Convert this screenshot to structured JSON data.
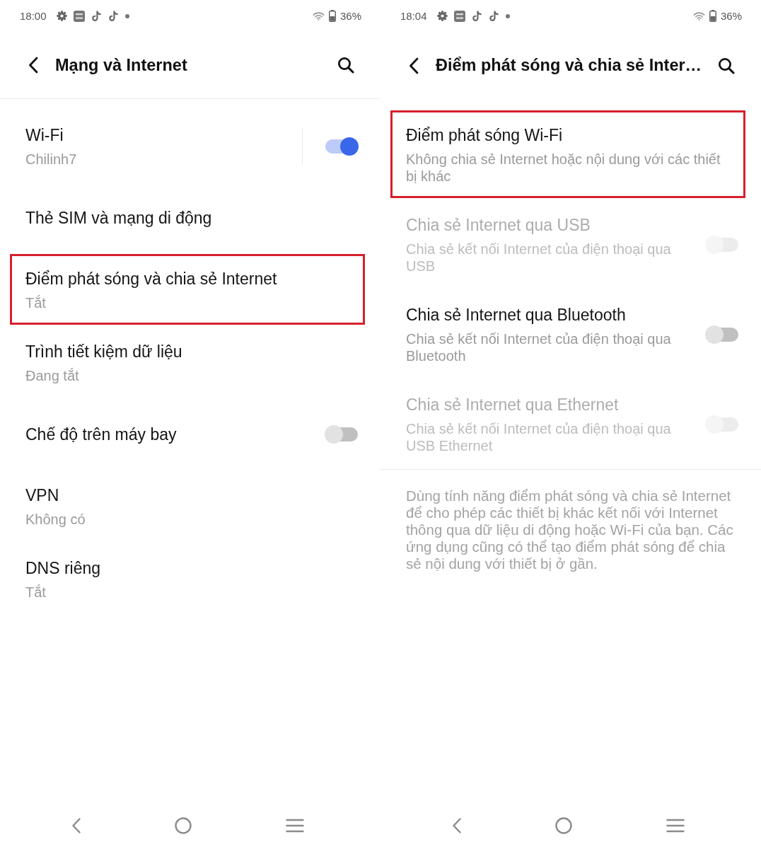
{
  "screens": [
    {
      "status_bar": {
        "time": "18:00",
        "battery": "36%"
      },
      "header": {
        "title": "Mạng và Internet",
        "divider": true
      },
      "items": [
        {
          "kind": "split-switch",
          "title": "Wi-Fi",
          "summary": "Chilinh7",
          "on": true,
          "disabled": false,
          "highlighted": false
        },
        {
          "kind": "link",
          "title": "Thẻ SIM và mạng di động",
          "disabled": false,
          "highlighted": false
        },
        {
          "kind": "link",
          "title": "Điểm phát sóng và chia sẻ Internet",
          "summary": "Tắt",
          "disabled": false,
          "highlighted": true
        },
        {
          "kind": "link",
          "title": "Trình tiết kiệm dữ liệu",
          "summary": "Đang tắt",
          "disabled": false,
          "highlighted": false
        },
        {
          "kind": "switch",
          "title": "Chế độ trên máy bay",
          "on": false,
          "disabled": false,
          "highlighted": false
        },
        {
          "kind": "link",
          "title": "VPN",
          "summary": "Không có",
          "disabled": false,
          "highlighted": false
        },
        {
          "kind": "link",
          "title": "DNS riêng",
          "summary": "Tắt",
          "disabled": false,
          "highlighted": false
        }
      ]
    },
    {
      "status_bar": {
        "time": "18:04",
        "battery": "36%"
      },
      "header": {
        "title": "Điểm phát sóng và chia sẻ Inter…",
        "divider": false
      },
      "items": [
        {
          "kind": "link",
          "title": "Điểm phát sóng Wi-Fi",
          "summary": "Không chia sẻ Internet hoặc nội dung với các thiết bị khác",
          "disabled": false,
          "highlighted": true
        },
        {
          "kind": "switch",
          "title": "Chia sẻ Internet qua USB",
          "summary": "Chia sẻ kết nối Internet của điện thoại qua USB",
          "on": false,
          "disabled": true,
          "highlighted": false
        },
        {
          "kind": "switch",
          "title": "Chia sẻ Internet qua Bluetooth",
          "summary": "Chia sẻ kết nối Internet của điện thoại qua Bluetooth",
          "on": false,
          "disabled": false,
          "highlighted": false
        },
        {
          "kind": "switch",
          "title": "Chia sẻ Internet qua Ethernet",
          "summary": "Chia sẻ kết nối Internet của điện thoại qua USB Ethernet",
          "on": false,
          "disabled": true,
          "highlighted": false
        }
      ],
      "footer_note": "Dùng tính năng điểm phát sóng và chia sẻ Internet để cho phép các thiết bị khác kết nối với Internet thông qua dữ liệu di động hoặc Wi-Fi của bạn. Các ứng dụng cũng có thể tạo điểm phát sóng để chia sẻ nội dung với thiết bị ở gần."
    }
  ]
}
